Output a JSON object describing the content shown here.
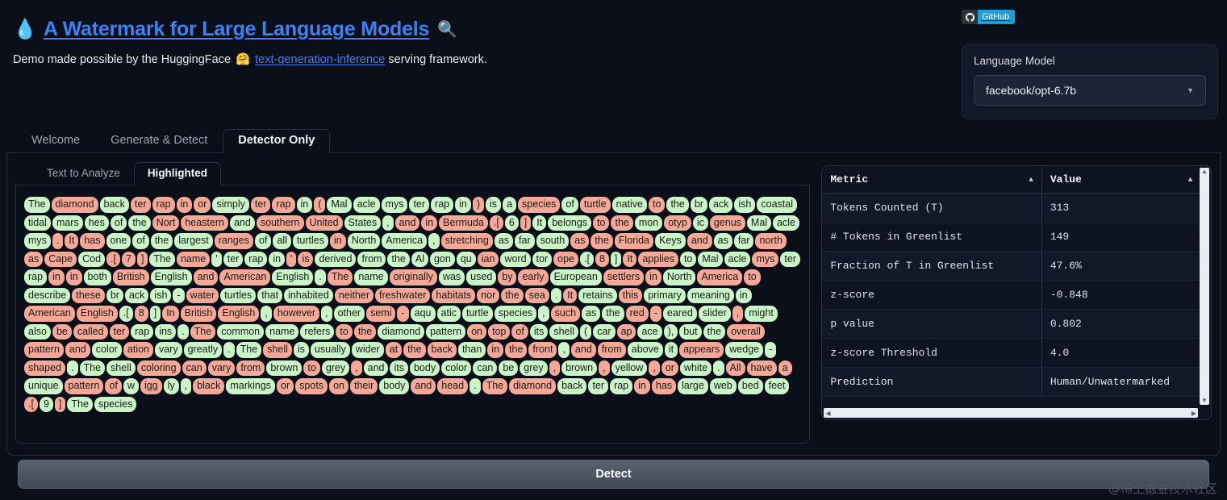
{
  "header": {
    "drop_icon": "💧",
    "title": "A Watermark for Large Language Models",
    "mag_icon": "🔍",
    "subtitle_pre": "Demo made possible by the HuggingFace ",
    "hf_icon": "🤗",
    "subtitle_link": "text-generation-inference",
    "subtitle_post": " serving framework."
  },
  "github_badge": {
    "icon": "github-icon",
    "label": "GitHub"
  },
  "language_model": {
    "label": "Language Model",
    "selected": "facebook/opt-6.7b",
    "caret": "▼"
  },
  "tabs_outer": [
    {
      "label": "Welcome",
      "active": false
    },
    {
      "label": "Generate & Detect",
      "active": false
    },
    {
      "label": "Detector Only",
      "active": true
    }
  ],
  "tabs_inner": [
    {
      "label": "Text to Analyze",
      "active": false
    },
    {
      "label": "Highlighted",
      "active": true
    }
  ],
  "table": {
    "columns": [
      {
        "label": "Metric",
        "sort": "▲"
      },
      {
        "label": "Value",
        "sort": "▲"
      }
    ],
    "rows": [
      {
        "metric": "Tokens Counted (T)",
        "value": "313"
      },
      {
        "metric": "# Tokens in Greenlist",
        "value": "149"
      },
      {
        "metric": "Fraction of T in Greenlist",
        "value": "47.6%"
      },
      {
        "metric": "z-score",
        "value": "-0.848"
      },
      {
        "metric": "p value",
        "value": "0.802"
      },
      {
        "metric": "z-score Threshold",
        "value": "4.0"
      },
      {
        "metric": "Prediction",
        "value": "Human/Unwatermarked"
      }
    ]
  },
  "detect_button": {
    "label": "Detect"
  },
  "watermark": {
    "text": "@稀土掘金技术社区"
  },
  "colors": {
    "greenlist": "#c9f5c7",
    "redlist": "#f6a896",
    "accent_link": "#3b82f6",
    "background": "#0b0f19",
    "panel_border": "#273043"
  },
  "highlighted_tokens": [
    {
      "t": "The",
      "c": "g"
    },
    {
      "t": "diamond",
      "c": "r"
    },
    {
      "t": "back",
      "c": "g"
    },
    {
      "t": "ter",
      "c": "r"
    },
    {
      "t": "rap",
      "c": "r"
    },
    {
      "t": "in",
      "c": "r"
    },
    {
      "t": "or",
      "c": "r"
    },
    {
      "t": "simply",
      "c": "g"
    },
    {
      "t": "ter",
      "c": "r"
    },
    {
      "t": "rap",
      "c": "r"
    },
    {
      "t": "in",
      "c": "g"
    },
    {
      "t": "(",
      "c": "r"
    },
    {
      "t": "Mal",
      "c": "g"
    },
    {
      "t": "acle",
      "c": "g"
    },
    {
      "t": "mys",
      "c": "g"
    },
    {
      "t": "ter",
      "c": "g"
    },
    {
      "t": "rap",
      "c": "g"
    },
    {
      "t": "in",
      "c": "g"
    },
    {
      "t": ")",
      "c": "r"
    },
    {
      "t": "is",
      "c": "g"
    },
    {
      "t": "a",
      "c": "g"
    },
    {
      "t": "species",
      "c": "r"
    },
    {
      "t": "of",
      "c": "g"
    },
    {
      "t": "turtle",
      "c": "r"
    },
    {
      "t": "native",
      "c": "g"
    },
    {
      "t": "to",
      "c": "r"
    },
    {
      "t": "the",
      "c": "g"
    },
    {
      "t": "br",
      "c": "g"
    },
    {
      "t": "ack",
      "c": "g"
    },
    {
      "t": "ish",
      "c": "g"
    },
    {
      "t": "coastal",
      "c": "g"
    },
    {
      "t": "tidal",
      "c": "g"
    },
    {
      "t": "mars",
      "c": "g"
    },
    {
      "t": "hes",
      "c": "g"
    },
    {
      "t": "of",
      "c": "g"
    },
    {
      "t": "the",
      "c": "g"
    },
    {
      "t": "Nort",
      "c": "r"
    },
    {
      "t": "heastern",
      "c": "r"
    },
    {
      "t": "and",
      "c": "g"
    },
    {
      "t": "southern",
      "c": "r"
    },
    {
      "t": "United",
      "c": "r"
    },
    {
      "t": "States",
      "c": "g"
    },
    {
      "t": ",",
      "c": "g"
    },
    {
      "t": "and",
      "c": "r"
    },
    {
      "t": "in",
      "c": "r"
    },
    {
      "t": "Bermuda",
      "c": "r"
    },
    {
      "t": ".[",
      "c": "r"
    },
    {
      "t": "6",
      "c": "g"
    },
    {
      "t": "]",
      "c": "r"
    },
    {
      "t": "It",
      "c": "g"
    },
    {
      "t": "belongs",
      "c": "g"
    },
    {
      "t": "to",
      "c": "r"
    },
    {
      "t": "the",
      "c": "r"
    },
    {
      "t": "mon",
      "c": "g"
    },
    {
      "t": "otyp",
      "c": "r"
    },
    {
      "t": "ic",
      "c": "g"
    },
    {
      "t": "genus",
      "c": "r"
    },
    {
      "t": "Mal",
      "c": "g"
    },
    {
      "t": "acle",
      "c": "g"
    },
    {
      "t": "mys",
      "c": "g"
    },
    {
      "t": ".",
      "c": "r"
    },
    {
      "t": "It",
      "c": "r"
    },
    {
      "t": "has",
      "c": "r"
    },
    {
      "t": "one",
      "c": "g"
    },
    {
      "t": "of",
      "c": "g"
    },
    {
      "t": "the",
      "c": "g"
    },
    {
      "t": "largest",
      "c": "g"
    },
    {
      "t": "ranges",
      "c": "r"
    },
    {
      "t": "of",
      "c": "g"
    },
    {
      "t": "all",
      "c": "g"
    },
    {
      "t": "turtles",
      "c": "g"
    },
    {
      "t": "in",
      "c": "r"
    },
    {
      "t": "North",
      "c": "g"
    },
    {
      "t": "America",
      "c": "g"
    },
    {
      "t": ",",
      "c": "g"
    },
    {
      "t": "stretching",
      "c": "r"
    },
    {
      "t": "as",
      "c": "g"
    },
    {
      "t": "far",
      "c": "g"
    },
    {
      "t": "south",
      "c": "g"
    },
    {
      "t": "as",
      "c": "r"
    },
    {
      "t": "the",
      "c": "r"
    },
    {
      "t": "Florida",
      "c": "r"
    },
    {
      "t": "Keys",
      "c": "g"
    },
    {
      "t": "and",
      "c": "r"
    },
    {
      "t": "as",
      "c": "g"
    },
    {
      "t": "far",
      "c": "g"
    },
    {
      "t": "north",
      "c": "r"
    },
    {
      "t": "as",
      "c": "r"
    },
    {
      "t": "Cape",
      "c": "r"
    },
    {
      "t": "Cod",
      "c": "g"
    },
    {
      "t": ".[",
      "c": "r"
    },
    {
      "t": "7",
      "c": "r"
    },
    {
      "t": "]",
      "c": "r"
    },
    {
      "t": "The",
      "c": "g"
    },
    {
      "t": "name",
      "c": "r"
    },
    {
      "t": "'",
      "c": "g"
    },
    {
      "t": "ter",
      "c": "g"
    },
    {
      "t": "rap",
      "c": "g"
    },
    {
      "t": "in",
      "c": "g"
    },
    {
      "t": "'",
      "c": "r"
    },
    {
      "t": "is",
      "c": "r"
    },
    {
      "t": "derived",
      "c": "g"
    },
    {
      "t": "from",
      "c": "g"
    },
    {
      "t": "the",
      "c": "g"
    },
    {
      "t": "Al",
      "c": "g"
    },
    {
      "t": "gon",
      "c": "g"
    },
    {
      "t": "qu",
      "c": "g"
    },
    {
      "t": "ian",
      "c": "r"
    },
    {
      "t": "word",
      "c": "g"
    },
    {
      "t": "tor",
      "c": "g"
    },
    {
      "t": "ope",
      "c": "r"
    },
    {
      "t": ".[",
      "c": "g"
    },
    {
      "t": "8",
      "c": "r"
    },
    {
      "t": "]",
      "c": "g"
    },
    {
      "t": "It",
      "c": "r"
    },
    {
      "t": "applies",
      "c": "r"
    },
    {
      "t": "to",
      "c": "g"
    },
    {
      "t": "Mal",
      "c": "g"
    },
    {
      "t": "acle",
      "c": "g"
    },
    {
      "t": "mys",
      "c": "r"
    },
    {
      "t": "ter",
      "c": "g"
    },
    {
      "t": "rap",
      "c": "g"
    },
    {
      "t": "in",
      "c": "r"
    },
    {
      "t": "in",
      "c": "r"
    },
    {
      "t": "both",
      "c": "g"
    },
    {
      "t": "British",
      "c": "r"
    },
    {
      "t": "English",
      "c": "g"
    },
    {
      "t": "and",
      "c": "r"
    },
    {
      "t": "American",
      "c": "r"
    },
    {
      "t": "English",
      "c": "g"
    },
    {
      "t": ".",
      "c": "g"
    },
    {
      "t": "The",
      "c": "r"
    },
    {
      "t": "name",
      "c": "g"
    },
    {
      "t": "originally",
      "c": "r"
    },
    {
      "t": "was",
      "c": "g"
    },
    {
      "t": "used",
      "c": "g"
    },
    {
      "t": "by",
      "c": "r"
    },
    {
      "t": "early",
      "c": "r"
    },
    {
      "t": "European",
      "c": "g"
    },
    {
      "t": "settlers",
      "c": "r"
    },
    {
      "t": "in",
      "c": "r"
    },
    {
      "t": "North",
      "c": "g"
    },
    {
      "t": "America",
      "c": "r"
    },
    {
      "t": "to",
      "c": "r"
    },
    {
      "t": "describe",
      "c": "g"
    },
    {
      "t": "these",
      "c": "r"
    },
    {
      "t": "br",
      "c": "g"
    },
    {
      "t": "ack",
      "c": "g"
    },
    {
      "t": "ish",
      "c": "g"
    },
    {
      "t": "-",
      "c": "g"
    },
    {
      "t": "water",
      "c": "r"
    },
    {
      "t": "turtles",
      "c": "g"
    },
    {
      "t": "that",
      "c": "g"
    },
    {
      "t": "inhabited",
      "c": "g"
    },
    {
      "t": "neither",
      "c": "r"
    },
    {
      "t": "freshwater",
      "c": "r"
    },
    {
      "t": "habitats",
      "c": "r"
    },
    {
      "t": "nor",
      "c": "r"
    },
    {
      "t": "the",
      "c": "r"
    },
    {
      "t": "sea",
      "c": "r"
    },
    {
      "t": ".",
      "c": "g"
    },
    {
      "t": "It",
      "c": "r"
    },
    {
      "t": "retains",
      "c": "g"
    },
    {
      "t": "this",
      "c": "r"
    },
    {
      "t": "primary",
      "c": "g"
    },
    {
      "t": "meaning",
      "c": "g"
    },
    {
      "t": "in",
      "c": "g"
    },
    {
      "t": "American",
      "c": "r"
    },
    {
      "t": "English",
      "c": "r"
    },
    {
      "t": ".[",
      "c": "g"
    },
    {
      "t": "8",
      "c": "r"
    },
    {
      "t": "]",
      "c": "g"
    },
    {
      "t": "In",
      "c": "r"
    },
    {
      "t": "British",
      "c": "r"
    },
    {
      "t": "English",
      "c": "r"
    },
    {
      "t": ",",
      "c": "g"
    },
    {
      "t": "however",
      "c": "r"
    },
    {
      "t": ",",
      "c": "g"
    },
    {
      "t": "other",
      "c": "g"
    },
    {
      "t": "semi",
      "c": "r"
    },
    {
      "t": "-",
      "c": "r"
    },
    {
      "t": "aqu",
      "c": "g"
    },
    {
      "t": "atic",
      "c": "g"
    },
    {
      "t": "turtle",
      "c": "g"
    },
    {
      "t": "species",
      "c": "g"
    },
    {
      "t": ",",
      "c": "g"
    },
    {
      "t": "such",
      "c": "r"
    },
    {
      "t": "as",
      "c": "g"
    },
    {
      "t": "the",
      "c": "g"
    },
    {
      "t": "red",
      "c": "r"
    },
    {
      "t": "-",
      "c": "r"
    },
    {
      "t": "eared",
      "c": "g"
    },
    {
      "t": "slider",
      "c": "g"
    },
    {
      "t": ",",
      "c": "r"
    },
    {
      "t": "might",
      "c": "g"
    },
    {
      "t": "also",
      "c": "g"
    },
    {
      "t": "be",
      "c": "r"
    },
    {
      "t": "called",
      "c": "r"
    },
    {
      "t": "ter",
      "c": "r"
    },
    {
      "t": "rap",
      "c": "g"
    },
    {
      "t": "ins",
      "c": "g"
    },
    {
      "t": ".",
      "c": "g"
    },
    {
      "t": "The",
      "c": "r"
    },
    {
      "t": "common",
      "c": "g"
    },
    {
      "t": "name",
      "c": "g"
    },
    {
      "t": "refers",
      "c": "g"
    },
    {
      "t": "to",
      "c": "r"
    },
    {
      "t": "the",
      "c": "r"
    },
    {
      "t": "diamond",
      "c": "g"
    },
    {
      "t": "pattern",
      "c": "g"
    },
    {
      "t": "on",
      "c": "r"
    },
    {
      "t": "top",
      "c": "r"
    },
    {
      "t": "of",
      "c": "r"
    },
    {
      "t": "its",
      "c": "g"
    },
    {
      "t": "shell",
      "c": "g"
    },
    {
      "t": "(",
      "c": "g"
    },
    {
      "t": "car",
      "c": "g"
    },
    {
      "t": "ap",
      "c": "r"
    },
    {
      "t": "ace",
      "c": "g"
    },
    {
      "t": "),",
      "c": "g"
    },
    {
      "t": "but",
      "c": "g"
    },
    {
      "t": "the",
      "c": "g"
    },
    {
      "t": "overall",
      "c": "r"
    },
    {
      "t": "pattern",
      "c": "r"
    },
    {
      "t": "and",
      "c": "r"
    },
    {
      "t": "color",
      "c": "g"
    },
    {
      "t": "ation",
      "c": "r"
    },
    {
      "t": "vary",
      "c": "g"
    },
    {
      "t": "greatly",
      "c": "g"
    },
    {
      "t": ".",
      "c": "g"
    },
    {
      "t": "The",
      "c": "g"
    },
    {
      "t": "shell",
      "c": "r"
    },
    {
      "t": "is",
      "c": "g"
    },
    {
      "t": "usually",
      "c": "g"
    },
    {
      "t": "wider",
      "c": "g"
    },
    {
      "t": "at",
      "c": "r"
    },
    {
      "t": "the",
      "c": "r"
    },
    {
      "t": "back",
      "c": "r"
    },
    {
      "t": "than",
      "c": "g"
    },
    {
      "t": "in",
      "c": "r"
    },
    {
      "t": "the",
      "c": "r"
    },
    {
      "t": "front",
      "c": "r"
    },
    {
      "t": ",",
      "c": "g"
    },
    {
      "t": "and",
      "c": "r"
    },
    {
      "t": "from",
      "c": "r"
    },
    {
      "t": "above",
      "c": "g"
    },
    {
      "t": "it",
      "c": "g"
    },
    {
      "t": "appears",
      "c": "r"
    },
    {
      "t": "wedge",
      "c": "g"
    },
    {
      "t": "-",
      "c": "g"
    },
    {
      "t": "shaped",
      "c": "r"
    },
    {
      "t": ".",
      "c": "g"
    },
    {
      "t": "The",
      "c": "g"
    },
    {
      "t": "shell",
      "c": "g"
    },
    {
      "t": "coloring",
      "c": "r"
    },
    {
      "t": "can",
      "c": "r"
    },
    {
      "t": "vary",
      "c": "r"
    },
    {
      "t": "from",
      "c": "r"
    },
    {
      "t": "brown",
      "c": "g"
    },
    {
      "t": "to",
      "c": "r"
    },
    {
      "t": "grey",
      "c": "g"
    },
    {
      "t": ",",
      "c": "r"
    },
    {
      "t": "and",
      "c": "g"
    },
    {
      "t": "its",
      "c": "g"
    },
    {
      "t": "body",
      "c": "g"
    },
    {
      "t": "color",
      "c": "g"
    },
    {
      "t": "can",
      "c": "g"
    },
    {
      "t": "be",
      "c": "g"
    },
    {
      "t": "grey",
      "c": "g"
    },
    {
      "t": ",",
      "c": "r"
    },
    {
      "t": "brown",
      "c": "g"
    },
    {
      "t": ",",
      "c": "r"
    },
    {
      "t": "yellow",
      "c": "g"
    },
    {
      "t": ",",
      "c": "r"
    },
    {
      "t": "or",
      "c": "r"
    },
    {
      "t": "white",
      "c": "g"
    },
    {
      "t": ".",
      "c": "g"
    },
    {
      "t": "All",
      "c": "r"
    },
    {
      "t": "have",
      "c": "r"
    },
    {
      "t": "a",
      "c": "r"
    },
    {
      "t": "unique",
      "c": "g"
    },
    {
      "t": "pattern",
      "c": "r"
    },
    {
      "t": "of",
      "c": "r"
    },
    {
      "t": "w",
      "c": "g"
    },
    {
      "t": "igg",
      "c": "r"
    },
    {
      "t": "ly",
      "c": "g"
    },
    {
      "t": ",",
      "c": "g"
    },
    {
      "t": "black",
      "c": "r"
    },
    {
      "t": "markings",
      "c": "g"
    },
    {
      "t": "or",
      "c": "r"
    },
    {
      "t": "spots",
      "c": "r"
    },
    {
      "t": "on",
      "c": "r"
    },
    {
      "t": "their",
      "c": "r"
    },
    {
      "t": "body",
      "c": "g"
    },
    {
      "t": "and",
      "c": "r"
    },
    {
      "t": "head",
      "c": "r"
    },
    {
      "t": ".",
      "c": "g"
    },
    {
      "t": "The",
      "c": "r"
    },
    {
      "t": "diamond",
      "c": "r"
    },
    {
      "t": "back",
      "c": "g"
    },
    {
      "t": "ter",
      "c": "g"
    },
    {
      "t": "rap",
      "c": "g"
    },
    {
      "t": "in",
      "c": "r"
    },
    {
      "t": "has",
      "c": "r"
    },
    {
      "t": "large",
      "c": "g"
    },
    {
      "t": "web",
      "c": "g"
    },
    {
      "t": "bed",
      "c": "g"
    },
    {
      "t": "feet",
      "c": "g"
    },
    {
      "t": ".[",
      "c": "r"
    },
    {
      "t": "9",
      "c": "g"
    },
    {
      "t": "]",
      "c": "r"
    },
    {
      "t": "The",
      "c": "g"
    },
    {
      "t": "species",
      "c": "g"
    }
  ]
}
